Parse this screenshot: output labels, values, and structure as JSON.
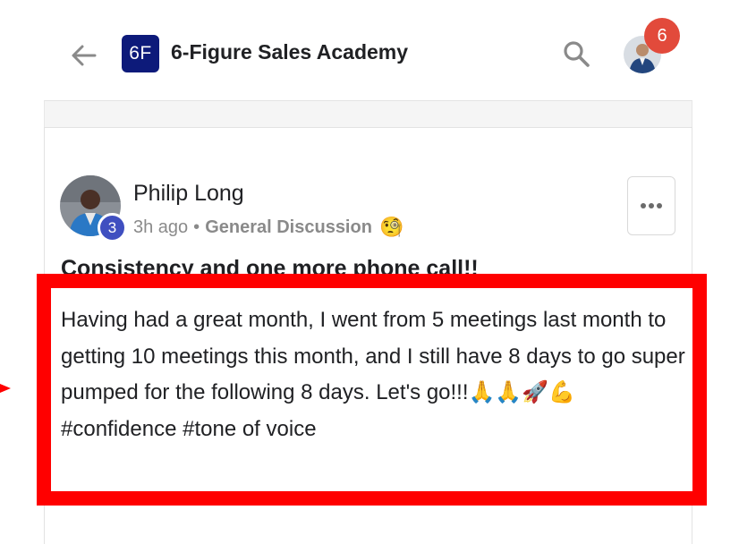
{
  "header": {
    "group_logo_text": "6F",
    "group_name": "6-Figure Sales Academy",
    "notification_count": "6"
  },
  "post": {
    "author": "Philip Long",
    "author_level": "3",
    "time": "3h ago",
    "separator": "•",
    "category": "General Discussion",
    "category_emoji": "🧐",
    "title": "Consistency and one more phone call!!",
    "body": "Having had a great month, I went from 5 meetings last month to getting 10 meetings this month, and I still have 8 days to go super pumped for the following 8 days. Let's go!!!🙏🙏🚀💪",
    "hashtags": "#confidence #tone of voice"
  },
  "colors": {
    "accent_logo": "#0d1a7a",
    "badge_red": "#e24a3b",
    "level_badge": "#3f4fc0",
    "highlight": "#ff0000"
  },
  "icons": {
    "back": "arrow-left-icon",
    "search": "search-icon",
    "more": "more-horizontal-icon"
  }
}
